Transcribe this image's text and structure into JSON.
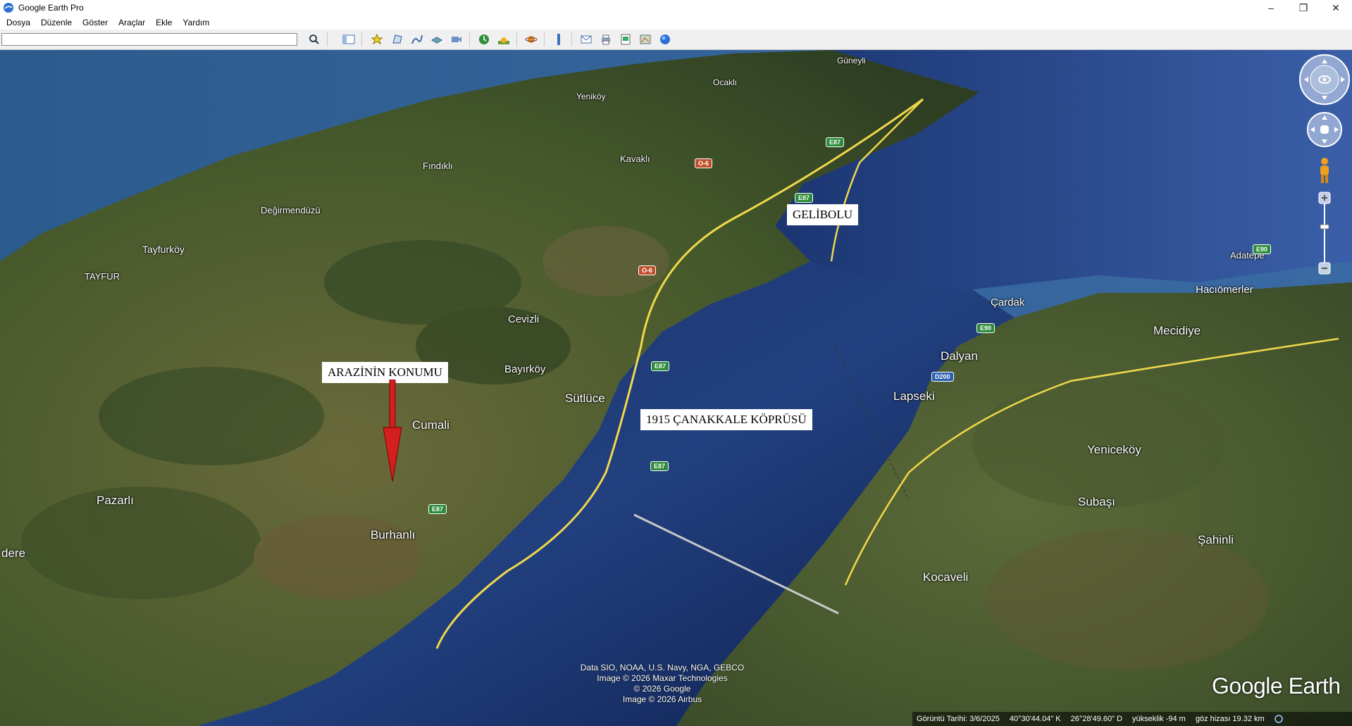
{
  "window": {
    "title": "Google Earth Pro",
    "minimize": "–",
    "restore": "❐",
    "close": "✕"
  },
  "menu": [
    "Dosya",
    "Düzenle",
    "Göster",
    "Araçlar",
    "Ekle",
    "Yardım"
  ],
  "search": {
    "value": "",
    "placeholder": ""
  },
  "toolbar_icons": [
    "search-icon",
    "sidebar-icon",
    "placemark-icon",
    "polygon-icon",
    "path-icon",
    "image-overlay-icon",
    "record-tour-icon",
    "historical-imagery-icon",
    "sun-icon",
    "planets-icon",
    "ruler-icon",
    "email-icon",
    "print-icon",
    "save-image-icon",
    "view-in-maps-icon",
    "earth-icon"
  ],
  "places": [
    {
      "name": "Güneyli"
    },
    {
      "name": "Ocaklı"
    },
    {
      "name": "Yeniköy"
    },
    {
      "name": "Kavaklı"
    },
    {
      "name": "Fındıklı"
    },
    {
      "name": "Değirmendüzü"
    },
    {
      "name": "Tayfurköy"
    },
    {
      "name": "TAYFUR"
    },
    {
      "name": "Cevizli"
    },
    {
      "name": "Bayırköy"
    },
    {
      "name": "Sütlüce"
    },
    {
      "name": "Cumali"
    },
    {
      "name": "Pazarlı"
    },
    {
      "name": "Burhanlı"
    },
    {
      "name": "dere"
    },
    {
      "name": "Adatepe"
    },
    {
      "name": "Hacıömerler"
    },
    {
      "name": "Çardak"
    },
    {
      "name": "Mecidiye"
    },
    {
      "name": "Dalyan"
    },
    {
      "name": "Lapseki"
    },
    {
      "name": "Yeniceköy"
    },
    {
      "name": "Subaşı"
    },
    {
      "name": "Şahinli"
    },
    {
      "name": "Kocaveli"
    }
  ],
  "annotations": {
    "gelibolu": "GELİBOLU",
    "location": "ARAZİNİN KONUMU",
    "bridge": "1915 ÇANAKKALE KÖPRÜSÜ"
  },
  "roads": [
    "E87",
    "E87",
    "E87",
    "O-6",
    "O-6",
    "E87",
    "E87",
    "E90",
    "E90",
    "D200"
  ],
  "credits": [
    "Data SIO, NOAA, U.S. Navy, NGA, GEBCO",
    "Image © 2026 Maxar Technologies",
    "© 2026 Google",
    "Image © 2026 Airbus"
  ],
  "logo": "Google Earth",
  "status": {
    "imagery_date": "Görüntü Tarihi: 3/6/2025",
    "lat": "40°30'44.04\" K",
    "lon": "26°28'49.60\" D",
    "elevation": "yükseklik   -94 m",
    "eye_alt": "göz hizası  19.32 km"
  },
  "nav": {
    "north": "N"
  },
  "colors": {
    "sea_dark": "#0d1f4a",
    "sea_mid": "#24417e",
    "land": "#4a5a30",
    "annotation_arrow": "#d41f1f",
    "road": "#f0d84a"
  }
}
